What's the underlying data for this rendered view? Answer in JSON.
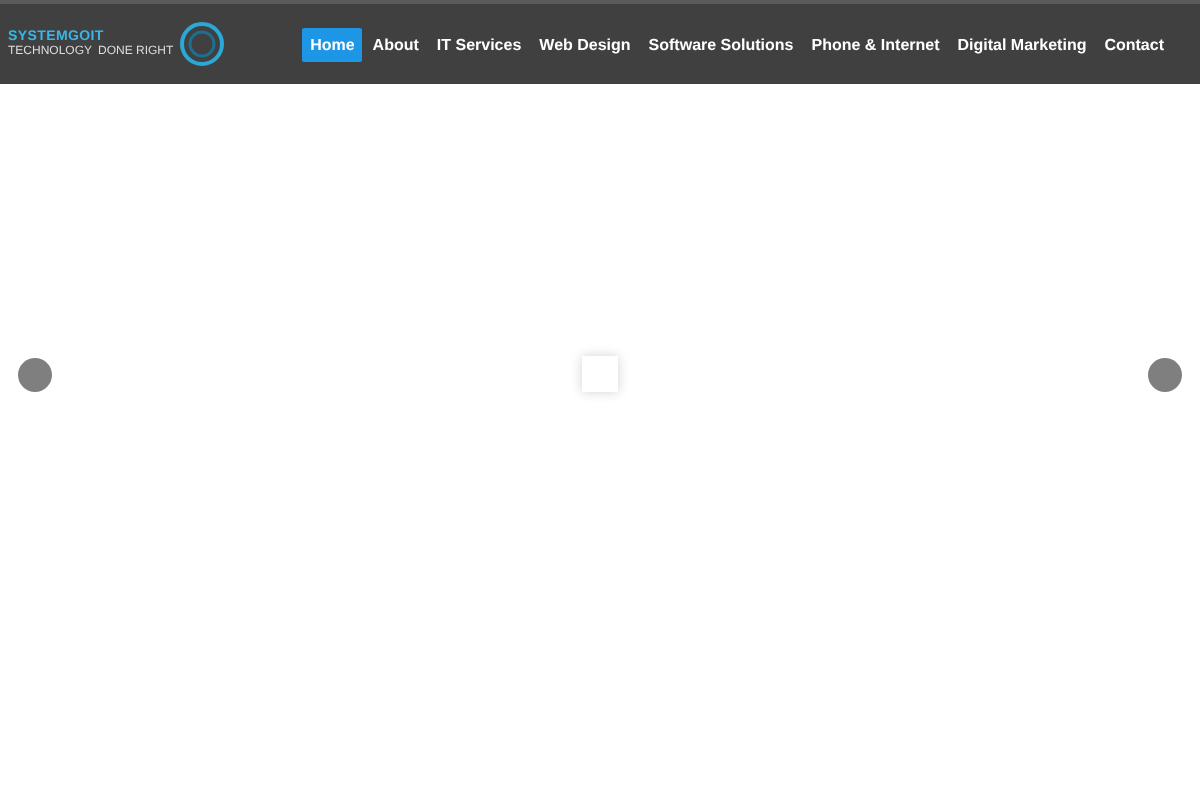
{
  "logo": {
    "name": "SYSTEMGOIT",
    "tagline_left": "TECHNOLOGY",
    "tagline_right": "DONE RIGHT"
  },
  "nav": [
    {
      "label": "Home",
      "selected": true
    },
    {
      "label": "About",
      "selected": false
    },
    {
      "label": "IT Services",
      "selected": false
    },
    {
      "label": "Web Design",
      "selected": false
    },
    {
      "label": "Software Solutions",
      "selected": false
    },
    {
      "label": "Phone & Internet",
      "selected": false
    },
    {
      "label": "Digital Marketing",
      "selected": false
    },
    {
      "label": "Contact",
      "selected": false
    }
  ]
}
